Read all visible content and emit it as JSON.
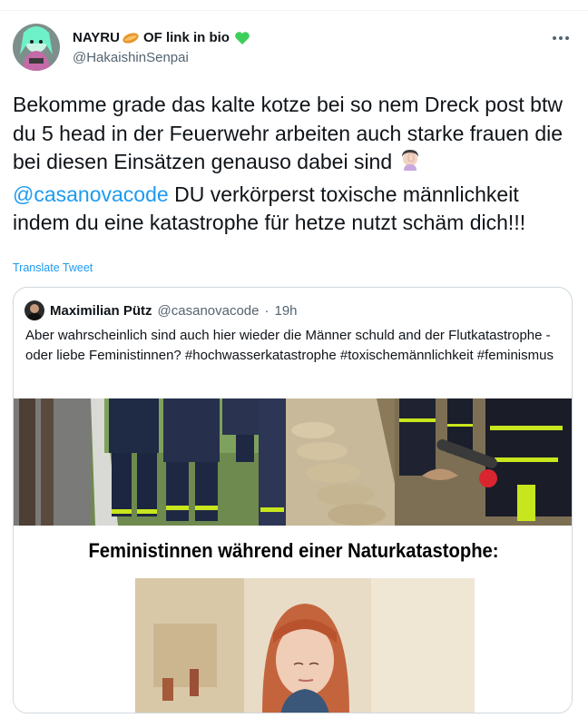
{
  "tweet": {
    "display_name": "NAYRU",
    "name_suffix": "OF link in bio",
    "handle": "@HakaishinSenpai",
    "text_before_mention": "Bekomme grade das kalte kotze bei so nem Dreck post btw du 5 head in der Feuerwehr arbeiten auch starke frauen die bei diesen Einsätzen genauso dabei sind ",
    "mention": "@casanovacode",
    "text_after_mention": " DU verkörperst toxische männlichkeit indem du eine katastrophe für hetze nutzt schäm dich!!!",
    "translate_label": "Translate Tweet",
    "more_icon": "more-horizontal-icon"
  },
  "quote": {
    "display_name": "Maximilian Pütz",
    "handle": "@casanovacode",
    "separator": "·",
    "time": "19h",
    "text": "Aber wahrscheinlich sind auch hier wieder die Männer schuld and der Flutkatastrophe - oder liebe Feministinnen? #hochwasserkatastrophe #toxischemännlichkeit #feminismus",
    "meme_caption": "Feministinnen während einer Naturkatastophe:"
  },
  "colors": {
    "link": "#1d9bf0",
    "secondary_text": "#536471",
    "border": "#cfd9de",
    "heart": "#3ecf5a",
    "firefighter_stripe": "#c8e61d"
  }
}
